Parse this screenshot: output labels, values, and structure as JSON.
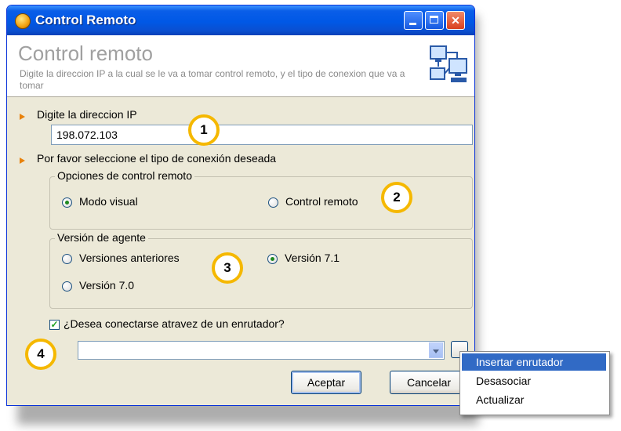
{
  "window": {
    "title": "Control Remoto",
    "controls": {
      "minimize": "minimize-icon",
      "maximize": "maximize-icon",
      "close": "close-icon"
    }
  },
  "header": {
    "title": "Control remoto",
    "description": "Digite la direccion IP a la cual se le va a tomar control remoto, y el tipo de conexion que va a tomar",
    "icon": "network-computers-icon"
  },
  "form": {
    "ip_label": "Digite la direccion IP",
    "ip_value": "198.072.103",
    "connection_label": "Por favor seleccione el tipo de conexión deseada",
    "remote_options": {
      "legend": "Opciones de control remoto",
      "option_visual": "Modo visual",
      "option_remote": "Control remoto",
      "selected": "Modo visual"
    },
    "agent_version": {
      "legend": "Versión de agente",
      "option_previous": "Versiones anteriores",
      "option_71": "Versión 7.1",
      "option_70": "Versión 7.0",
      "selected": "Versión 7.1"
    },
    "router_checkbox": {
      "label": "¿Desea conectarse atravez de un enrutador?",
      "checked": true
    },
    "router_select": {
      "value": ""
    }
  },
  "buttons": {
    "accept": "Aceptar",
    "cancel": "Cancelar"
  },
  "context_menu": {
    "items": [
      "Insertar enrutador",
      "Desasociar",
      "Actualizar"
    ],
    "highlighted": "Insertar enrutador"
  },
  "markers": [
    "1",
    "2",
    "3",
    "4"
  ],
  "colors": {
    "titlebar": "#0058e6",
    "marker_ring": "#f5b800",
    "bullet_arrow": "#e8820c",
    "menu_highlight": "#316ac5"
  }
}
